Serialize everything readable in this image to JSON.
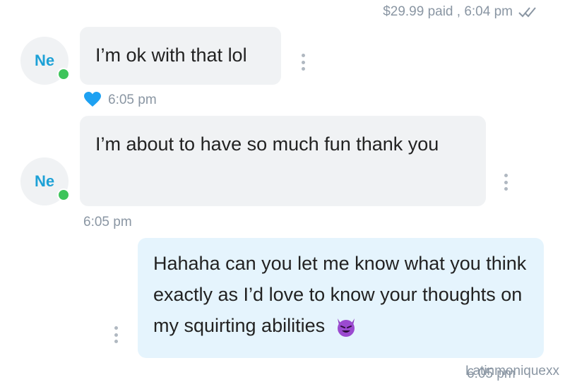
{
  "header": {
    "payment_info": "$29.99 paid , 6:04 pm"
  },
  "messages": [
    {
      "sender_initials": "Ne",
      "text": "I’m ok with that lol",
      "time": "6:05 pm",
      "liked": true
    },
    {
      "sender_initials": "Ne",
      "text": "I’m about to have so much fun thank you",
      "time": "6:05 pm",
      "liked": false
    },
    {
      "text": "Hahaha can you let me know what you think exactly as I’d love to know your thoughts on my squirting abilities",
      "time": "6:05 pm"
    }
  ],
  "watermark": "Latinmoniquexx",
  "colors": {
    "avatar_text": "#1da1d6",
    "online": "#3ec45b",
    "heart": "#1da1f2",
    "incoming_bubble": "#f0f2f4",
    "outgoing_bubble": "#e5f4fd",
    "meta_text": "#8a96a3"
  },
  "icons": [
    "double-check-icon",
    "heart-icon",
    "more-options-icon",
    "smiling-devil-emoji"
  ]
}
